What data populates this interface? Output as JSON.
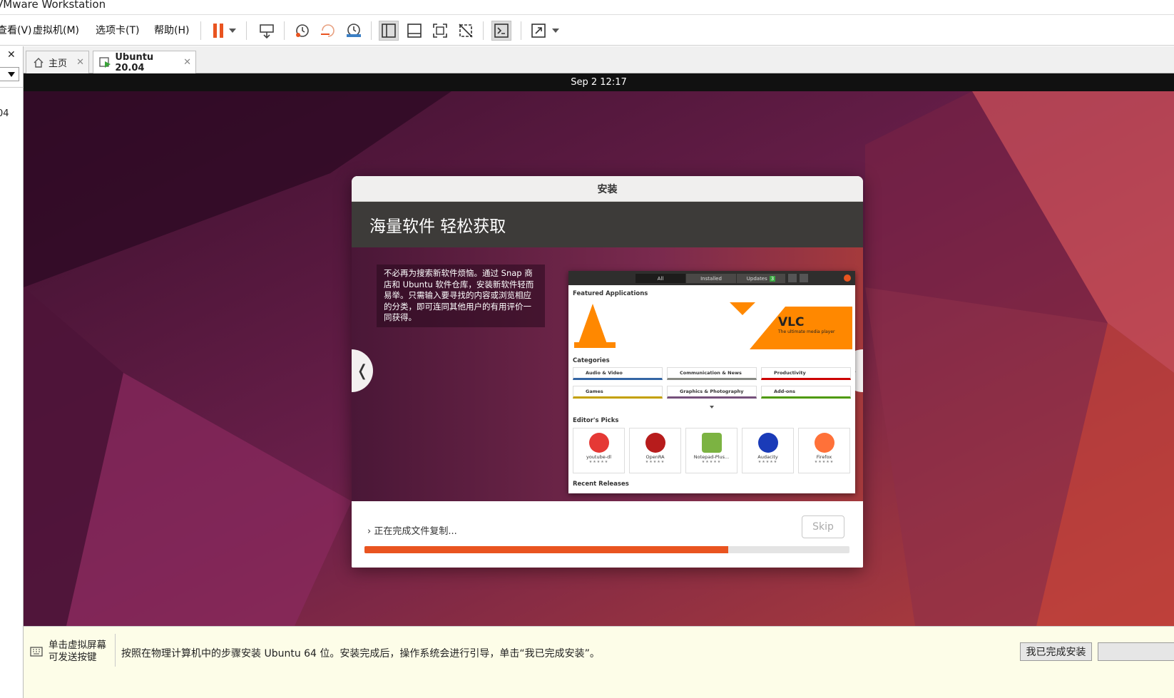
{
  "window": {
    "title": "VMware Workstation"
  },
  "menu": {
    "items": [
      "查看(V)",
      "虚拟机(M)",
      "选项卡(T)",
      "帮助(H)"
    ]
  },
  "toolbar": {
    "icons": [
      "pause-icon",
      "send-ctrl-alt-del-icon",
      "snapshot-take-icon",
      "snapshot-revert-icon",
      "snapshot-manager-icon",
      "library-view-icon",
      "thumbnail-view-icon",
      "full-screen-icon",
      "unity-icon",
      "console-icon",
      "stretch-icon"
    ]
  },
  "left_panel": {
    "close_glyph": "✕",
    "item_text": "04"
  },
  "tabs": [
    {
      "label": "主页",
      "icon": "home-icon"
    },
    {
      "label": "Ubuntu 20.04",
      "icon": "vm-running-icon"
    }
  ],
  "guest": {
    "clock": "Sep 2  12:17",
    "installer": {
      "window_title": "安装",
      "banner_title": "海量软件 轻松获取",
      "slide_text": "不必再为搜索新软件烦恼。通过 Snap 商店和 Ubuntu 软件仓库，安装新软件轻而易举。只需输入要寻找的内容或浏览相应的分类，即可连同其他用户的有用评价一同获得。",
      "prev_glyph": "❬",
      "next_glyph": "❭",
      "store": {
        "tabs": [
          "All",
          "Installed",
          "Updates"
        ],
        "updates_count": "3",
        "featured_label": "Featured Applications",
        "featured_app": "VLC",
        "featured_tagline": "The ultimate media player",
        "categories_label": "Categories",
        "categories": [
          "Audio & Video",
          "Communication & News",
          "Productivity",
          "Games",
          "Graphics & Photography",
          "Add-ons"
        ],
        "category_colors": [
          "#3465a4",
          "#888a85",
          "#cc0000",
          "#c4a000",
          "#75507b",
          "#4e9a06"
        ],
        "editors_label": "Editor's Picks",
        "picks": [
          "youtube-dl",
          "OpenRA",
          "Notepad-Plus...",
          "Audacity",
          "Firefox"
        ],
        "pick_stars": "★★★★★",
        "recent_label": "Recent Releases"
      },
      "status_text": "正在完成文件复制...",
      "status_chevron": "›",
      "skip_label": "Skip",
      "progress_fraction": 0.75,
      "accent": "#e95420"
    }
  },
  "hint": {
    "left_line1": "单击虚拟屏幕",
    "left_line2": "可发送按键",
    "message": "按照在物理计算机中的步骤安装 Ubuntu 64 位。安装完成后，操作系统会进行引导，单击“我已完成安装”。",
    "done_button": "我已完成安装"
  }
}
